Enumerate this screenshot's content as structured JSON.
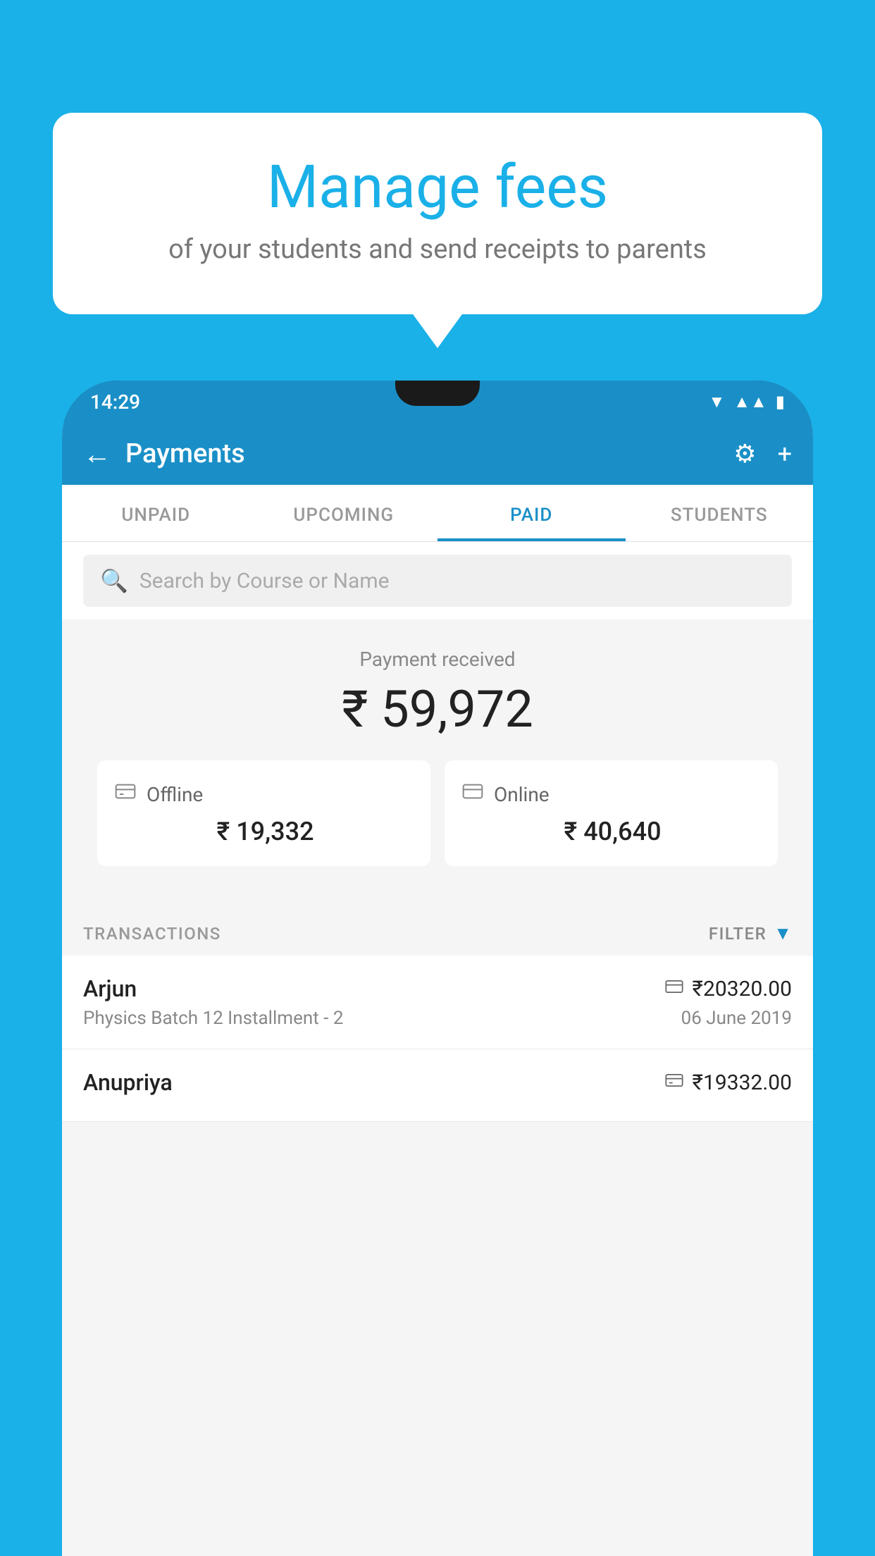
{
  "background_color": "#1ab0e8",
  "speech_bubble": {
    "title": "Manage fees",
    "subtitle": "of your students and send receipts to parents"
  },
  "phone": {
    "status_bar": {
      "time": "14:29",
      "icons": [
        "wifi",
        "signal",
        "battery"
      ]
    },
    "app_bar": {
      "title": "Payments",
      "back_icon": "←",
      "settings_icon": "⚙",
      "add_icon": "+"
    },
    "tabs": [
      {
        "label": "UNPAID",
        "active": false
      },
      {
        "label": "UPCOMING",
        "active": false
      },
      {
        "label": "PAID",
        "active": true
      },
      {
        "label": "STUDENTS",
        "active": false
      }
    ],
    "search": {
      "placeholder": "Search by Course or Name"
    },
    "payment_summary": {
      "label": "Payment received",
      "amount": "₹ 59,972",
      "offline_label": "Offline",
      "offline_amount": "₹ 19,332",
      "online_label": "Online",
      "online_amount": "₹ 40,640"
    },
    "transactions": {
      "section_label": "TRANSACTIONS",
      "filter_label": "FILTER",
      "items": [
        {
          "name": "Arjun",
          "course": "Physics Batch 12 Installment - 2",
          "amount": "₹20320.00",
          "date": "06 June 2019",
          "payment_mode": "online"
        },
        {
          "name": "Anupriya",
          "course": "",
          "amount": "₹19332.00",
          "date": "",
          "payment_mode": "offline"
        }
      ]
    }
  }
}
